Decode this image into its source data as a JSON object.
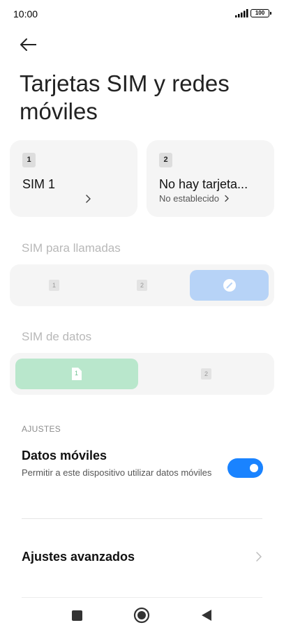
{
  "status_bar": {
    "time": "10:00",
    "battery": "100",
    "icons": [
      "signal-icon",
      "battery-icon"
    ]
  },
  "header": {
    "back_icon": "back-arrow-icon",
    "title": "Tarjetas SIM y redes móviles"
  },
  "sim_cards": [
    {
      "slot": "1",
      "name": "SIM 1",
      "subtitle": ""
    },
    {
      "slot": "2",
      "name": "No hay tarjeta...",
      "subtitle": "No establecido"
    }
  ],
  "calls": {
    "label": "SIM para llamadas",
    "options": [
      "1",
      "2"
    ],
    "selected_icon": "edit-icon"
  },
  "data": {
    "label": "SIM de datos",
    "options": [
      "1",
      "2"
    ],
    "selected_index": 0
  },
  "settings": {
    "header": "AJUSTES",
    "mobile_data": {
      "title": "Datos móviles",
      "description": "Permitir a este dispositivo utilizar datos móviles",
      "enabled": true
    },
    "advanced": {
      "label": "Ajustes avanzados"
    }
  },
  "navigation": {
    "buttons": [
      "recents-square-icon",
      "home-circle-icon",
      "back-triangle-icon"
    ]
  },
  "colors": {
    "accent": "#1a83ff",
    "calls_selected": "#b7d3f7",
    "data_selected": "#b9e7cc"
  }
}
